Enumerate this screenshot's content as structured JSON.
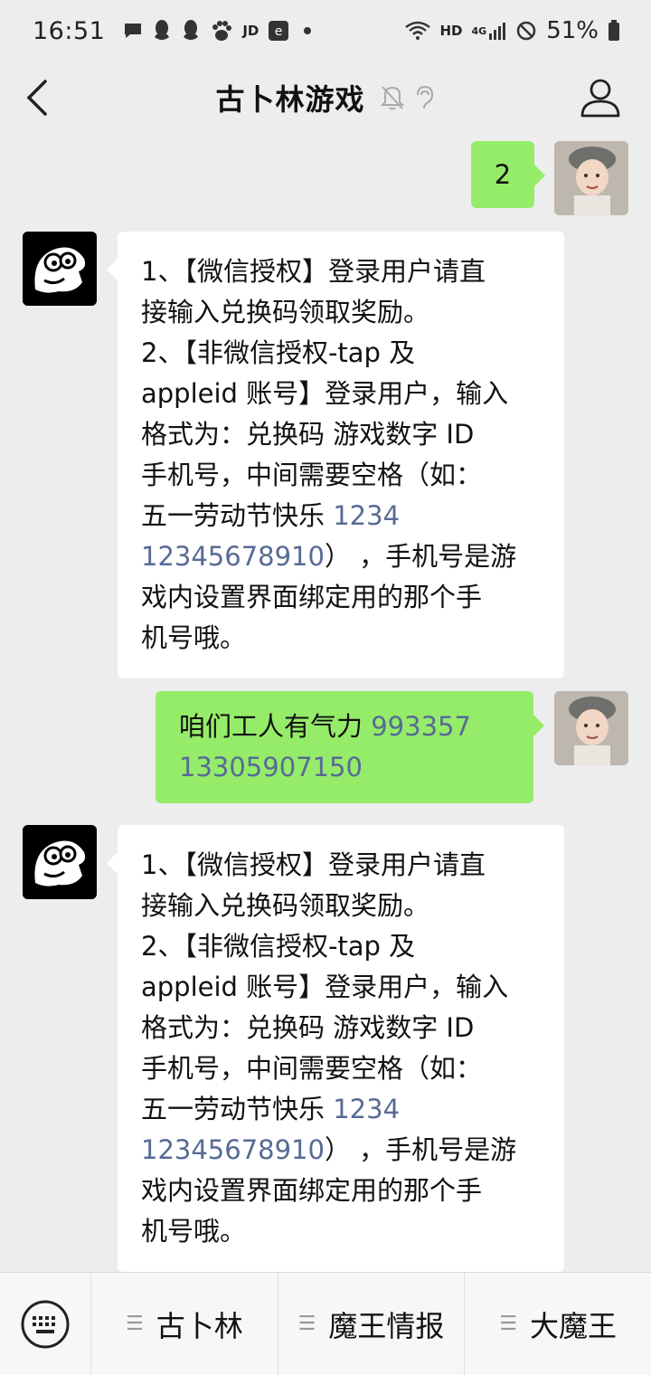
{
  "status_bar": {
    "time": "16:51",
    "badge_jd": "JD",
    "network_hd": "HD",
    "network_4g": "4G",
    "battery": "51%"
  },
  "nav": {
    "title": "古卜林游戏"
  },
  "messages": [
    {
      "side": "right",
      "text": "2"
    },
    {
      "side": "left",
      "lines": [
        "1、【微信授权】登录用户请直",
        "接输入兑换码领取奖励。",
        "2、【非微信授权-tap 及",
        "appleid 账号】登录用户，输入",
        "格式为：兑换码 游戏数字 ID",
        "手机号，中间需要空格（如：",
        "五一劳动节快乐 ",
        "） ，手机号是游",
        "戏内设置界面绑定用的那个手",
        "机号哦。"
      ],
      "link1": "1234",
      "link2": "12345678910"
    },
    {
      "side": "right",
      "text_prefix": "咱们工人有气力 ",
      "link1": "993357",
      "link2": "13305907150"
    },
    {
      "side": "left",
      "lines": [
        "1、【微信授权】登录用户请直",
        "接输入兑换码领取奖励。",
        "2、【非微信授权-tap 及",
        "appleid 账号】登录用户，输入",
        "格式为：兑换码 游戏数字 ID",
        "手机号，中间需要空格（如：",
        "五一劳动节快乐 ",
        "）  ，手机号是游",
        "戏内设置界面绑定用的那个手",
        "机号哦。"
      ],
      "link1": "1234",
      "link2": "12345678910"
    }
  ],
  "bottom_menu": {
    "items": [
      "古卜林",
      "魔王情报",
      "大魔王"
    ]
  },
  "colors": {
    "bg": "#ededed",
    "bubble_self": "#95ec69",
    "link": "#576b95"
  }
}
